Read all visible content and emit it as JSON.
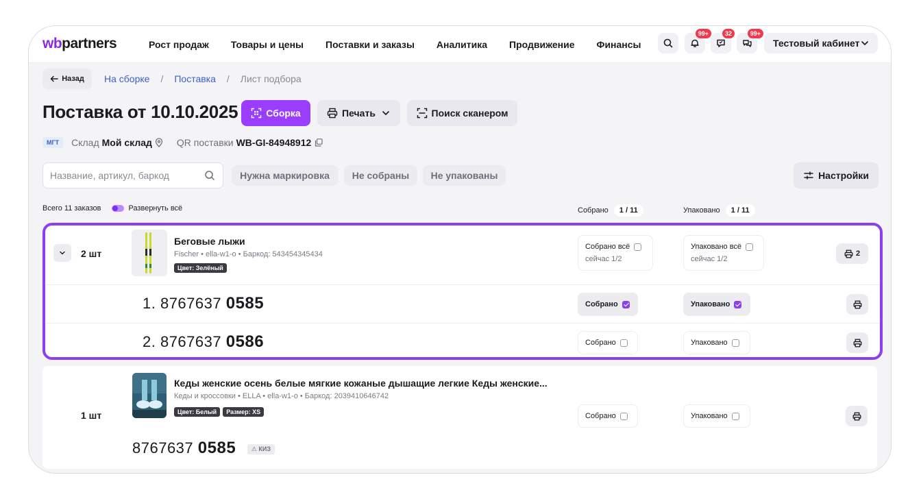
{
  "header": {
    "logo_wb": "wb",
    "logo_rest": "partners",
    "nav": [
      "Рост продаж",
      "Товары и цены",
      "Поставки и заказы",
      "Аналитика",
      "Продвижение",
      "Финансы"
    ],
    "badges": {
      "notifications": "99+",
      "feedback": "32",
      "chat": "99+"
    },
    "account": "Тестовый кабинет"
  },
  "page": {
    "back_label": "Назад",
    "breadcrumbs": [
      "На сборке",
      "Поставка",
      "Лист подбора"
    ],
    "title": "Поставка от 10.10.2025",
    "btn_assembly": "Сборка",
    "btn_print": "Печать",
    "btn_scanner": "Поиск сканером",
    "meta": {
      "tag": "МГТ",
      "warehouse_label": "Склад",
      "warehouse_value": "Мой склад",
      "qr_label": "QR поставки",
      "qr_value": "WB-GI-84948912"
    },
    "search_placeholder": "Название, артикул, баркод",
    "filters": [
      "Нужна маркировка",
      "Не собраны",
      "Не упакованы"
    ],
    "settings": "Настройки",
    "total_orders": "Всего 11 заказов",
    "expand_all": "Развернуть всё",
    "collected_label": "Собрано",
    "collected_value": "1 / 11",
    "packed_label": "Упаковано",
    "packed_value": "1 / 11"
  },
  "orders": [
    {
      "qty": "2 шт",
      "name": "Беговые лыжи",
      "sub": "Fischer • ella-w1-o • Баркод: 543454345434",
      "tags": [
        "Цвет: Зелёный"
      ],
      "collected_all": "Собрано всё",
      "collected_now": "сейчас 1/2",
      "packed_all": "Упаковано всё",
      "packed_now": "сейчас 1/2",
      "print_count": "2",
      "items": [
        {
          "prefix": "1. 8767637",
          "suffix": "0585",
          "collected": "Собрано",
          "collected_checked": true,
          "packed": "Упаковано",
          "packed_checked": true
        },
        {
          "prefix": "2. 8767637",
          "suffix": "0586",
          "collected": "Собрано",
          "collected_checked": false,
          "packed": "Упаковано",
          "packed_checked": false
        }
      ]
    },
    {
      "qty": "1 шт",
      "name": "Кеды женские осень белые мягкие кожаные дышащие легкие Кеды женские...",
      "sub": "Кеды и кроссовки • ELLA • ella-w1-o • Баркод: 2039410646742",
      "tags": [
        "Цвет: Белый",
        "Размер: XS"
      ],
      "code_prefix": "8767637",
      "code_suffix": "0585",
      "kiz": "КИЗ",
      "collected": "Собрано",
      "packed": "Упаковано"
    }
  ]
}
